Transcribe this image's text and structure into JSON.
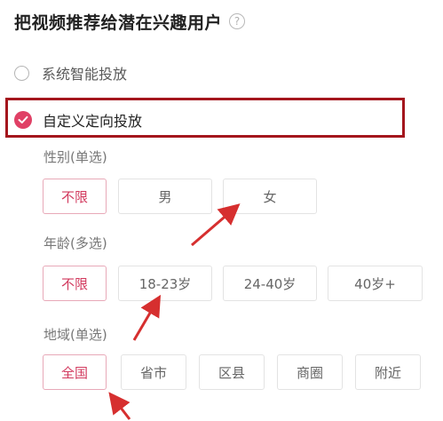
{
  "header": {
    "title": "把视频推荐给潜在兴趣用户",
    "help_icon_glyph": "?"
  },
  "delivery_modes": {
    "smart": {
      "label": "系统智能投放",
      "selected": false
    },
    "custom": {
      "label": "自定义定向投放",
      "selected": true
    }
  },
  "gender": {
    "label": "性别(单选)",
    "options": [
      "不限",
      "男",
      "女"
    ],
    "selected": "不限"
  },
  "age": {
    "label": "年龄(多选)",
    "options": [
      "不限",
      "18-23岁",
      "24-40岁",
      "40岁+"
    ],
    "selected": "不限"
  },
  "region": {
    "label": "地域(单选)",
    "options": [
      "全国",
      "省市",
      "区县",
      "商圈",
      "附近"
    ],
    "selected": "全国"
  },
  "colors": {
    "accent": "#e04065",
    "highlight_box": "#a4161d",
    "arrow": "#d62f2f"
  },
  "icons": {
    "help": "question-circle-icon",
    "selected_radio": "check-circle-icon",
    "annotation": "red-arrow-icon"
  }
}
